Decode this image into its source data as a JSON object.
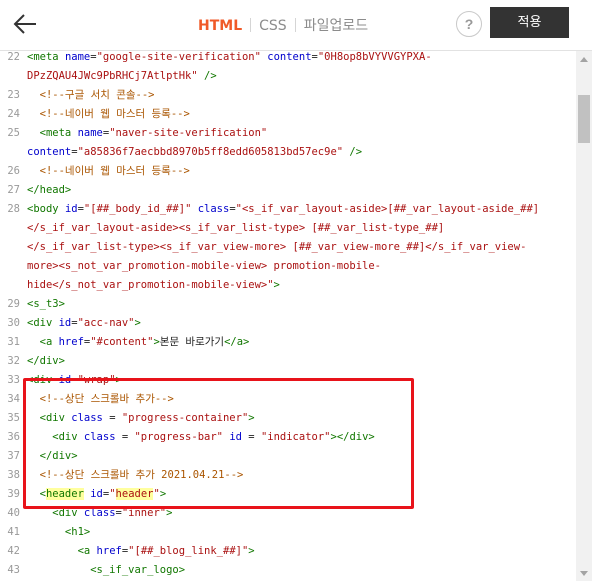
{
  "toolbar": {
    "tabs": [
      {
        "label": "HTML",
        "active": true
      },
      {
        "label": "CSS",
        "active": false
      },
      {
        "label": "파일업로드",
        "active": false
      }
    ],
    "help_label": "?",
    "apply_label": "적용",
    "back_icon": "arrow-left-icon"
  },
  "colors": {
    "active_tab": "#f05a28",
    "apply_button": "#333333",
    "highlight_box": "#e8131a",
    "tag": "#117700",
    "attribute": "#0000cc",
    "string": "#aa1111",
    "comment": "#aa5500",
    "selection_highlight": "#ffff9e"
  },
  "editor": {
    "lines": [
      {
        "num": "22",
        "tokens": [
          {
            "t": "<meta ",
            "c": "tag"
          },
          {
            "t": "name",
            "c": "attr"
          },
          {
            "t": "=",
            "c": ""
          },
          {
            "t": "\"google-site-verification\"",
            "c": "str"
          },
          {
            "t": " ",
            "c": ""
          },
          {
            "t": "content",
            "c": "attr"
          },
          {
            "t": "=",
            "c": ""
          },
          {
            "t": "\"0H8op8bVYVVGYPXA-",
            "c": "str"
          }
        ]
      },
      {
        "num": "",
        "tokens": [
          {
            "t": "DPzZQAU4JWc9PbRHCj7AtlptHk\"",
            "c": "str"
          },
          {
            "t": " />",
            "c": "tag"
          }
        ]
      },
      {
        "num": "23",
        "tokens": [
          {
            "t": "  <!--구글 서치 콘솔-->",
            "c": "com"
          }
        ]
      },
      {
        "num": "24",
        "tokens": [
          {
            "t": "  <!--네이버 웹 마스터 등록-->",
            "c": "com"
          }
        ]
      },
      {
        "num": "25",
        "tokens": [
          {
            "t": "  <meta ",
            "c": "tag"
          },
          {
            "t": "name",
            "c": "attr"
          },
          {
            "t": "=",
            "c": ""
          },
          {
            "t": "\"naver-site-verification\"",
            "c": "str"
          }
        ]
      },
      {
        "num": "",
        "tokens": [
          {
            "t": "content",
            "c": "attr"
          },
          {
            "t": "=",
            "c": ""
          },
          {
            "t": "\"a85836f7aecbbd8970b5ff8edd605813bd57ec9e\"",
            "c": "str"
          },
          {
            "t": " />",
            "c": "tag"
          }
        ]
      },
      {
        "num": "26",
        "tokens": [
          {
            "t": "  <!--네이버 웹 마스터 등록-->",
            "c": "com"
          }
        ]
      },
      {
        "num": "27",
        "tokens": [
          {
            "t": "</head>",
            "c": "tag"
          }
        ]
      },
      {
        "num": "28",
        "tokens": [
          {
            "t": "<body ",
            "c": "tag"
          },
          {
            "t": "id",
            "c": "attr"
          },
          {
            "t": "=",
            "c": ""
          },
          {
            "t": "\"[##_body_id_##]\"",
            "c": "str"
          },
          {
            "t": " ",
            "c": ""
          },
          {
            "t": "class",
            "c": "attr"
          },
          {
            "t": "=",
            "c": ""
          },
          {
            "t": "\"<s_if_var_layout-aside>[##_var_layout-aside_##]",
            "c": "str"
          }
        ]
      },
      {
        "num": "",
        "tokens": [
          {
            "t": "</s_if_var_layout-aside><s_if_var_list-type> [##_var_list-type_##]",
            "c": "str"
          }
        ]
      },
      {
        "num": "",
        "tokens": [
          {
            "t": "</s_if_var_list-type><s_if_var_view-more> [##_var_view-more_##]</s_if_var_view-",
            "c": "str"
          }
        ]
      },
      {
        "num": "",
        "tokens": [
          {
            "t": "more><s_not_var_promotion-mobile-view> promotion-mobile-",
            "c": "str"
          }
        ]
      },
      {
        "num": "",
        "tokens": [
          {
            "t": "hide</s_not_var_promotion-mobile-view>\"",
            "c": "str"
          },
          {
            "t": ">",
            "c": "tag"
          }
        ]
      },
      {
        "num": "29",
        "tokens": [
          {
            "t": "<s_t3>",
            "c": "tag"
          }
        ]
      },
      {
        "num": "30",
        "tokens": [
          {
            "t": "<div ",
            "c": "tag"
          },
          {
            "t": "id",
            "c": "attr"
          },
          {
            "t": "=",
            "c": ""
          },
          {
            "t": "\"acc-nav\"",
            "c": "str"
          },
          {
            "t": ">",
            "c": "tag"
          }
        ]
      },
      {
        "num": "31",
        "tokens": [
          {
            "t": "  <a ",
            "c": "tag"
          },
          {
            "t": "href",
            "c": "attr"
          },
          {
            "t": "=",
            "c": ""
          },
          {
            "t": "\"#content\"",
            "c": "str"
          },
          {
            "t": ">",
            "c": "tag"
          },
          {
            "t": "본문 바로가기",
            "c": ""
          },
          {
            "t": "</a>",
            "c": "tag"
          }
        ]
      },
      {
        "num": "32",
        "tokens": [
          {
            "t": "</div>",
            "c": "tag"
          }
        ]
      },
      {
        "num": "33",
        "tokens": [
          {
            "t": "<div ",
            "c": "tag"
          },
          {
            "t": "id",
            "c": "attr"
          },
          {
            "t": "=",
            "c": ""
          },
          {
            "t": "\"wrap\"",
            "c": "str"
          },
          {
            "t": ">",
            "c": "tag"
          }
        ]
      },
      {
        "num": "34",
        "tokens": [
          {
            "t": "  <!--상단 스크롤바 추가-->",
            "c": "com"
          }
        ]
      },
      {
        "num": "35",
        "tokens": [
          {
            "t": "  <div ",
            "c": "tag"
          },
          {
            "t": "class",
            "c": "attr"
          },
          {
            "t": " = ",
            "c": ""
          },
          {
            "t": "\"progress-container\"",
            "c": "str"
          },
          {
            "t": ">",
            "c": "tag"
          }
        ]
      },
      {
        "num": "36",
        "tokens": [
          {
            "t": "    <div ",
            "c": "tag"
          },
          {
            "t": "class",
            "c": "attr"
          },
          {
            "t": " = ",
            "c": ""
          },
          {
            "t": "\"progress-bar\"",
            "c": "str"
          },
          {
            "t": " ",
            "c": ""
          },
          {
            "t": "id",
            "c": "attr"
          },
          {
            "t": " = ",
            "c": ""
          },
          {
            "t": "\"indicator\"",
            "c": "str"
          },
          {
            "t": "></div>",
            "c": "tag"
          }
        ]
      },
      {
        "num": "37",
        "tokens": [
          {
            "t": "  </div>",
            "c": "tag"
          }
        ]
      },
      {
        "num": "38",
        "tokens": [
          {
            "t": "  <!--상단 스크롤바 추가 2021.04.21-->",
            "c": "com"
          }
        ]
      },
      {
        "num": "39",
        "tokens": [
          {
            "t": "  <",
            "c": "tag"
          },
          {
            "t": "header",
            "c": "tag hl"
          },
          {
            "t": " ",
            "c": ""
          },
          {
            "t": "id",
            "c": "attr"
          },
          {
            "t": "=",
            "c": ""
          },
          {
            "t": "\"",
            "c": "str"
          },
          {
            "t": "header",
            "c": "str hl"
          },
          {
            "t": "\"",
            "c": "str"
          },
          {
            "t": ">",
            "c": "tag"
          }
        ]
      },
      {
        "num": "40",
        "tokens": [
          {
            "t": "    <div ",
            "c": "tag"
          },
          {
            "t": "class",
            "c": "attr"
          },
          {
            "t": "=",
            "c": ""
          },
          {
            "t": "\"inner\"",
            "c": "str"
          },
          {
            "t": ">",
            "c": "tag"
          }
        ]
      },
      {
        "num": "41",
        "tokens": [
          {
            "t": "      <h1>",
            "c": "tag"
          }
        ]
      },
      {
        "num": "42",
        "tokens": [
          {
            "t": "        <a ",
            "c": "tag"
          },
          {
            "t": "href",
            "c": "attr"
          },
          {
            "t": "=",
            "c": ""
          },
          {
            "t": "\"[##_blog_link_##]\"",
            "c": "str"
          },
          {
            "t": ">",
            "c": "tag"
          }
        ]
      },
      {
        "num": "43",
        "tokens": [
          {
            "t": "          <s_if_var_logo>",
            "c": "tag"
          }
        ]
      }
    ]
  }
}
